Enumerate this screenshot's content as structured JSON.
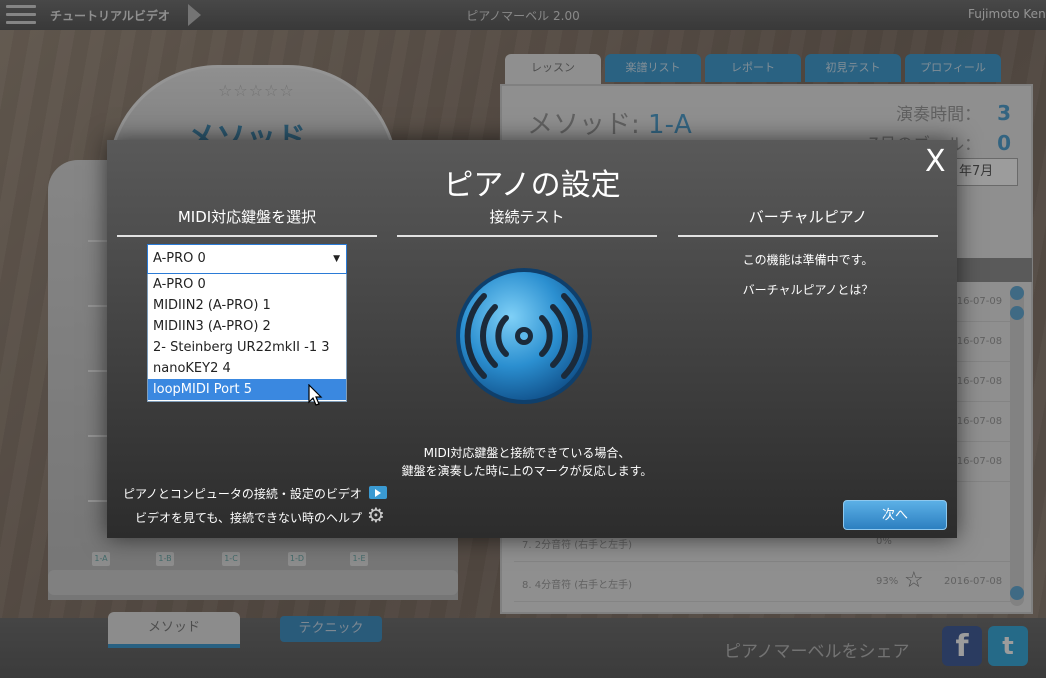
{
  "app": {
    "title": "ピアノマーベル 2.00",
    "tutorial_label": "チュートリアルビデオ",
    "user": "Fujimoto Ken"
  },
  "cabinet": {
    "title": "メソッド",
    "stars": "☆☆☆☆☆",
    "levels": [
      "1-A",
      "1-B",
      "1-C",
      "1-D",
      "1-E"
    ]
  },
  "bottom": {
    "tab_method": "メソッド",
    "tab_technique": "テクニック",
    "share_text": "ピアノマーベルをシェア",
    "facebook_glyph": "f",
    "twitter_glyph": "t"
  },
  "right_panel": {
    "tabs": [
      "レッスン",
      "楽譜リスト",
      "レポート",
      "初見テスト",
      "プロフィール"
    ],
    "method_label": "メソッド:",
    "method_value": "1-A",
    "play_time_label": "演奏時間：",
    "play_time_value": "3",
    "goal_label": "7月のゴール：",
    "goal_value": "0",
    "month_select": "年7月",
    "rows": [
      {
        "name": "",
        "percent": "",
        "date": "2016-07-09"
      },
      {
        "name": "",
        "percent": "",
        "date": "2016-07-08"
      },
      {
        "name": "",
        "percent": "",
        "date": "2016-07-08"
      },
      {
        "name": "",
        "percent": "",
        "date": "2016-07-08"
      },
      {
        "name": "",
        "percent": "",
        "date": "2016-07-08"
      },
      {
        "name": "7. 2分音符 (右手と左手)",
        "percent": "0%",
        "date": ""
      },
      {
        "name": "8. 4分音符 (右手と左手)",
        "percent": "93%",
        "date": "2016-07-08"
      }
    ]
  },
  "modal": {
    "title": "ピアノの設定",
    "close": "X",
    "col_midi": "MIDI対応鍵盤を選択",
    "col_test": "接続テスト",
    "col_virtual": "バーチャルピアノ",
    "selected": "A-PRO 0",
    "options": [
      "A-PRO 0",
      "MIDIIN2 (A-PRO) 1",
      "MIDIIN3 (A-PRO) 2",
      "2- Steinberg UR22mkII -1 3",
      "nanoKEY2 4",
      "loopMIDI Port 5"
    ],
    "highlighted_option": "loopMIDI Port 5",
    "test_note_line1": "MIDI対応鍵盤と接続できている場合、",
    "test_note_line2": "鍵盤を演奏した時に上のマークが反応します。",
    "virtual_note": "この機能は準備中です。",
    "virtual_link": "バーチャルピアノとは？",
    "help_video": "ピアノとコンピュータの接続・設定のビデオ",
    "help_link": "ビデオを見ても、接続できない時のヘルプ",
    "next_button": "次へ"
  },
  "colors": {
    "accent": "#3a9ad2",
    "highlight": "#3a88e0",
    "modal_bg": "#3c3c3c"
  }
}
